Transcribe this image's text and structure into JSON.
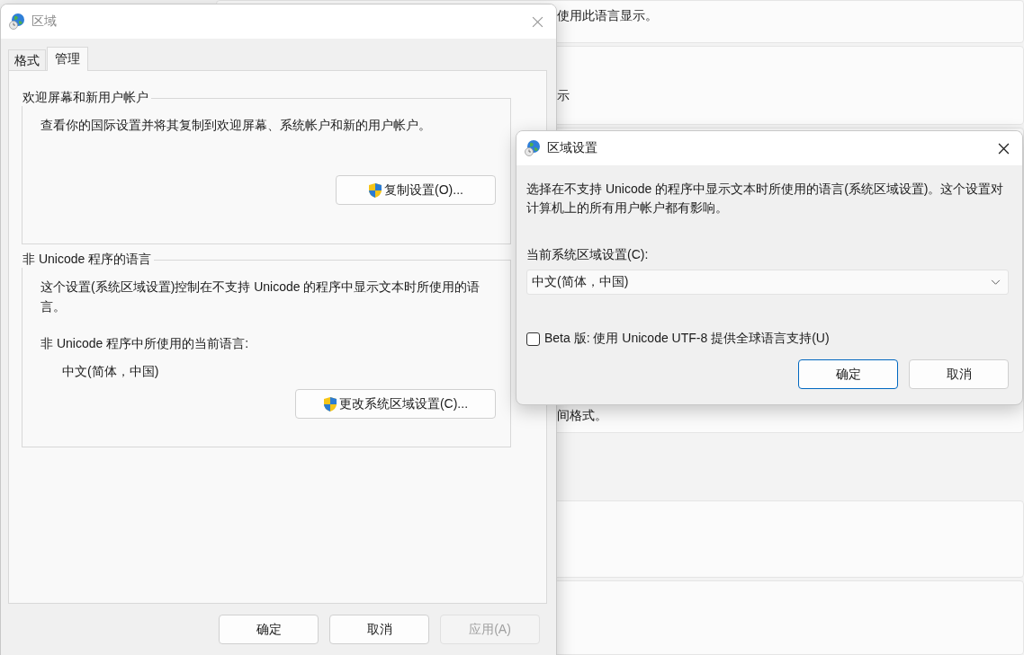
{
  "settings_background": {
    "texts": [
      "使用此语言显示。",
      "示",
      "间格式。"
    ]
  },
  "region_window": {
    "title": "区域",
    "tabs": [
      {
        "label": "格式",
        "selected": false
      },
      {
        "label": "管理",
        "selected": true
      }
    ],
    "welcome_group": {
      "legend": "欢迎屏幕和新用户帐户",
      "text": "查看你的国际设置并将其复制到欢迎屏幕、系统帐户和新的用户帐户。",
      "button": "复制设置(O)..."
    },
    "non_unicode_group": {
      "legend": "非 Unicode 程序的语言",
      "text": "这个设置(系统区域设置)控制在不支持 Unicode 的程序中显示文本时所使用的语言。",
      "current_label": "非 Unicode 程序中所使用的当前语言:",
      "current_value": "中文(简体，中国)",
      "button": "更改系统区域设置(C)..."
    },
    "buttons": [
      {
        "label": "确定",
        "disabled": false
      },
      {
        "label": "取消",
        "disabled": false
      },
      {
        "label": "应用(A)",
        "disabled": true
      }
    ]
  },
  "locale_dialog": {
    "title": "区域设置",
    "description": "选择在不支持 Unicode 的程序中显示文本时所使用的语言(系统区域设置)。这个设置对计算机上的所有用户帐户都有影响。",
    "field_label": "当前系统区域设置(C):",
    "locale_select": {
      "value": "中文(简体，中国)"
    },
    "beta_checkbox": {
      "label": "Beta 版: 使用 Unicode UTF-8 提供全球语言支持(U)",
      "checked": false
    },
    "buttons": [
      {
        "label": "确定",
        "default": true
      },
      {
        "label": "取消",
        "default": false
      }
    ]
  }
}
